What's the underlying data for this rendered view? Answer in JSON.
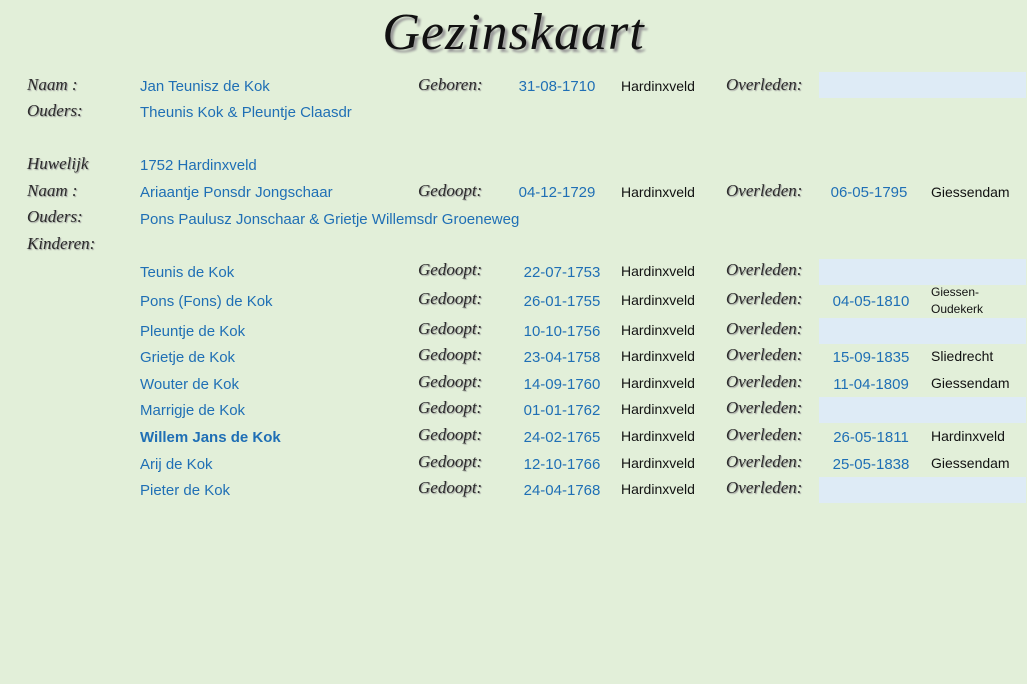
{
  "title": "Gezinskaart",
  "labels": {
    "naam": "Naam :",
    "ouders": "Ouders:",
    "huwelijk": "Huwelijk",
    "kinderen": "Kinderen:",
    "geboren": "Geboren:",
    "gedoopt": "Gedoopt:",
    "overleden": "Overleden:"
  },
  "husband": {
    "name": "Jan Teunisz de Kok",
    "date": "31-08-1710",
    "place": "Hardinxveld",
    "parents": "Theunis Kok & Pleuntje Claasdr"
  },
  "marriage": "1752 Hardinxveld",
  "wife": {
    "name": "Ariaantje Ponsdr Jongschaar",
    "date": "04-12-1729",
    "place": "Hardinxveld",
    "death_date": "06-05-1795",
    "death_place": "Giessendam",
    "parents": "Pons Paulusz Jonschaar & Grietje Willemsdr Groeneweg"
  },
  "children": [
    {
      "name": "Teunis de Kok",
      "date": "22-07-1753",
      "place": "Hardinxveld",
      "death_date": "",
      "death_place": ""
    },
    {
      "name": "Pons (Fons) de Kok",
      "date": "26-01-1755",
      "place": "Hardinxveld",
      "death_date": "04-05-1810",
      "death_place": "Giessen-\nOudekerk"
    },
    {
      "name": "Pleuntje de Kok",
      "date": "10-10-1756",
      "place": "Hardinxveld",
      "death_date": "",
      "death_place": ""
    },
    {
      "name": "Grietje de Kok",
      "date": "23-04-1758",
      "place": "Hardinxveld",
      "death_date": "15-09-1835",
      "death_place": "Sliedrecht"
    },
    {
      "name": "Wouter de Kok",
      "date": "14-09-1760",
      "place": "Hardinxveld",
      "death_date": "11-04-1809",
      "death_place": "Giessendam"
    },
    {
      "name": "Marrigje de Kok",
      "date": "01-01-1762",
      "place": "Hardinxveld",
      "death_date": "",
      "death_place": ""
    },
    {
      "name": "Willem Jans de Kok",
      "date": "24-02-1765",
      "place": "Hardinxveld",
      "death_date": "26-05-1811",
      "death_place": "Hardinxveld"
    },
    {
      "name": "Arij de Kok",
      "date": "12-10-1766",
      "place": "Hardinxveld",
      "death_date": "25-05-1838",
      "death_place": "Giessendam"
    },
    {
      "name": "Pieter de Kok",
      "date": "24-04-1768",
      "place": "Hardinxveld",
      "death_date": "",
      "death_place": ""
    }
  ],
  "colors": {
    "background": "#e2efd9",
    "value_text": "#1f6fb5",
    "empty_cell": "#deebf6"
  }
}
